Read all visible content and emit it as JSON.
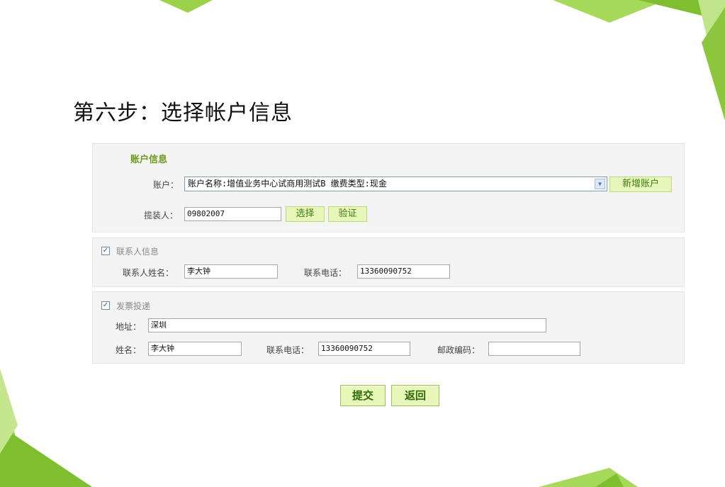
{
  "page": {
    "title": "第六步：选择帐户信息"
  },
  "account_section": {
    "title": "账户信息",
    "account_label": "账户：",
    "account_value": "账户名称:增值业务中心试商用测试B 缴费类型:现金",
    "add_account_label": "新增账户",
    "installer_label": "揽装人：",
    "installer_value": "09802007",
    "select_label": "选择",
    "verify_label": "验证"
  },
  "contact_section": {
    "checked": true,
    "title": "联系人信息",
    "name_label": "联系人姓名：",
    "name_value": "李大钟",
    "phone_label": "联系电话：",
    "phone_value": "13360090752"
  },
  "invoice_section": {
    "checked": true,
    "title": "发票投递",
    "address_label": "地址：",
    "address_value": "深圳",
    "name_label": "姓名：",
    "name_value": "李大钟",
    "phone_label": "联系电话：",
    "phone_value": "13360090752",
    "postcode_label": "邮政编码：",
    "postcode_value": ""
  },
  "actions": {
    "submit_label": "提交",
    "back_label": "返回"
  },
  "colors": {
    "accent_green": "#8cc63f",
    "dark_green": "#6a9a1a",
    "button_bg": "#e7f7b9"
  },
  "icons": {
    "dropdown": "chevron-down-icon",
    "checkbox": "check-icon"
  }
}
